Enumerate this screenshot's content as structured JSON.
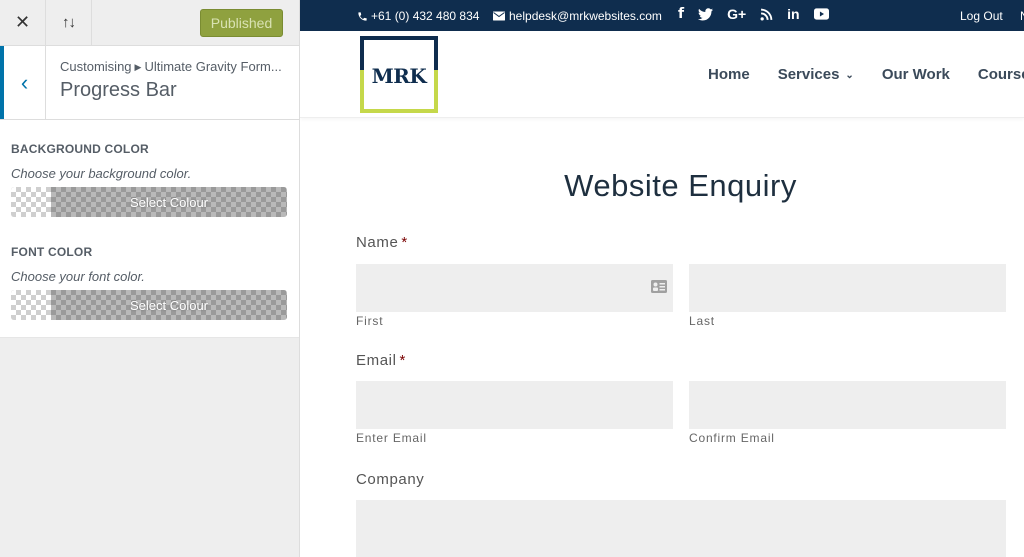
{
  "customizer": {
    "close_icon": "close-icon",
    "reorder_icon": "arrows-up-down-icon",
    "publish_label": "Published",
    "back_icon": "chevron-left-icon",
    "breadcrumb": {
      "root": "Customising",
      "separator_icon": "caret-right-icon",
      "section": "Ultimate Gravity Form..."
    },
    "section_title": "Progress Bar",
    "controls": [
      {
        "label": "BACKGROUND COLOR",
        "description": "Choose your background color.",
        "button_label": "Select Colour"
      },
      {
        "label": "FONT COLOR",
        "description": "Choose your font color.",
        "button_label": "Select Colour"
      }
    ]
  },
  "site": {
    "topbar": {
      "phone_icon": "phone-icon",
      "phone": "+61 (0) 432 480 834",
      "email_icon": "envelope-icon",
      "email": "helpdesk@mrkwebsites.com",
      "social": [
        "f",
        "twitter",
        "G+",
        "rss",
        "in",
        "youtube"
      ],
      "logout": "Log Out",
      "cut_off_item": "N"
    },
    "logo_text": "MRK",
    "nav": [
      {
        "label": "Home"
      },
      {
        "label": "Services",
        "has_dropdown": true
      },
      {
        "label": "Our Work"
      },
      {
        "label": "Course"
      }
    ],
    "colors": {
      "navy": "#0f2d4e",
      "lime": "#c5d84a",
      "publish_green": "#8fa13f",
      "wp_blue": "#0073aa"
    }
  },
  "form": {
    "title": "Website Enquiry",
    "fields": {
      "name": {
        "label": "Name",
        "required_mark": "*",
        "first_value": "",
        "first_sublabel": "First",
        "last_value": "",
        "last_sublabel": "Last"
      },
      "email": {
        "label": "Email",
        "required_mark": "*",
        "enter_value": "",
        "enter_sublabel": "Enter Email",
        "confirm_value": "",
        "confirm_sublabel": "Confirm Email"
      },
      "company": {
        "label": "Company",
        "value": ""
      }
    }
  }
}
